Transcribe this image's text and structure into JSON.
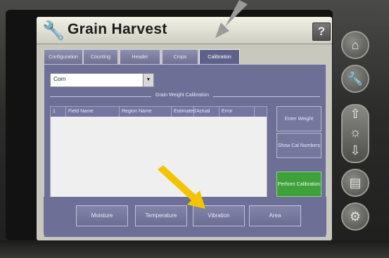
{
  "app": {
    "title": "Grain Harvest",
    "help_label": "?"
  },
  "tabs": [
    {
      "label": "Configuration",
      "active": false
    },
    {
      "label": "Counting",
      "active": false
    },
    {
      "label": "Header",
      "active": false
    },
    {
      "label": "Crops",
      "active": false
    },
    {
      "label": "Calibration",
      "active": true
    }
  ],
  "crop_select": {
    "value": "Corn",
    "arrow": "▼"
  },
  "section_label": "Grain Weight Calibration",
  "table": {
    "columns": [
      "1",
      "Field Name",
      "Region Name",
      "Estimated",
      "Actual",
      "Error"
    ]
  },
  "side_buttons": {
    "enter_weight": "Enter Weight",
    "show_cal_numbers": "Show Cal Numbers",
    "perform_calibration": "Perform Calibration"
  },
  "bottom_buttons": [
    "Moisture",
    "Temperature",
    "Vibration",
    "Area"
  ],
  "icons": {
    "title": "wrench-icon",
    "right_panel": [
      "home-icon",
      "wrench-icon",
      "brightness-icon",
      "manual-icon",
      "runner-icon"
    ]
  },
  "colors": {
    "panel": "#6e6f96",
    "title_bar": "#e8e7dc",
    "perform_calibration": "#3fa13a",
    "annotation_gray": "#9a9a9a",
    "annotation_yellow": "#f5c400"
  }
}
